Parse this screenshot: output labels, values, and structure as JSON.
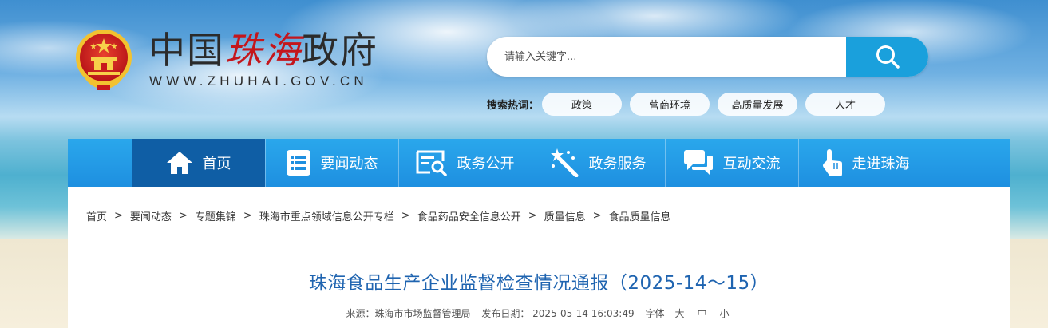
{
  "header": {
    "title_prefix": "中国",
    "title_accent": "珠海",
    "title_suffix": "政府",
    "url": "WWW.ZHUHAI.GOV.CN"
  },
  "search": {
    "placeholder": "请输入关键字...",
    "icon": "search-icon"
  },
  "hot": {
    "label": "搜索热词：",
    "tags": [
      "政策",
      "营商环境",
      "高质量发展",
      "人才"
    ]
  },
  "nav": {
    "items": [
      {
        "label": "首页",
        "icon": "home-icon"
      },
      {
        "label": "要闻动态",
        "icon": "list-icon"
      },
      {
        "label": "政务公开",
        "icon": "document-search-icon"
      },
      {
        "label": "政务服务",
        "icon": "magic-wand-icon"
      },
      {
        "label": "互动交流",
        "icon": "chat-icon"
      },
      {
        "label": "走进珠海",
        "icon": "hand-pointer-icon"
      }
    ],
    "active_color": "#0f5ea5",
    "bar_color": "#1e8fe0"
  },
  "breadcrumb": {
    "items": [
      "首页",
      "要闻动态",
      "专题集锦",
      "珠海市重点领域信息公开专栏",
      "食品药品安全信息公开",
      "质量信息",
      "食品质量信息"
    ],
    "separator": ">"
  },
  "article": {
    "title": "珠海食品生产企业监督检查情况通报（2025-14～15）",
    "source": "来源：珠海市市场监督管理局",
    "date": "发布日期： 2025-05-14 16:03:49",
    "font_label": "字体",
    "font_large": "大",
    "font_medium": "中",
    "font_small": "小"
  }
}
